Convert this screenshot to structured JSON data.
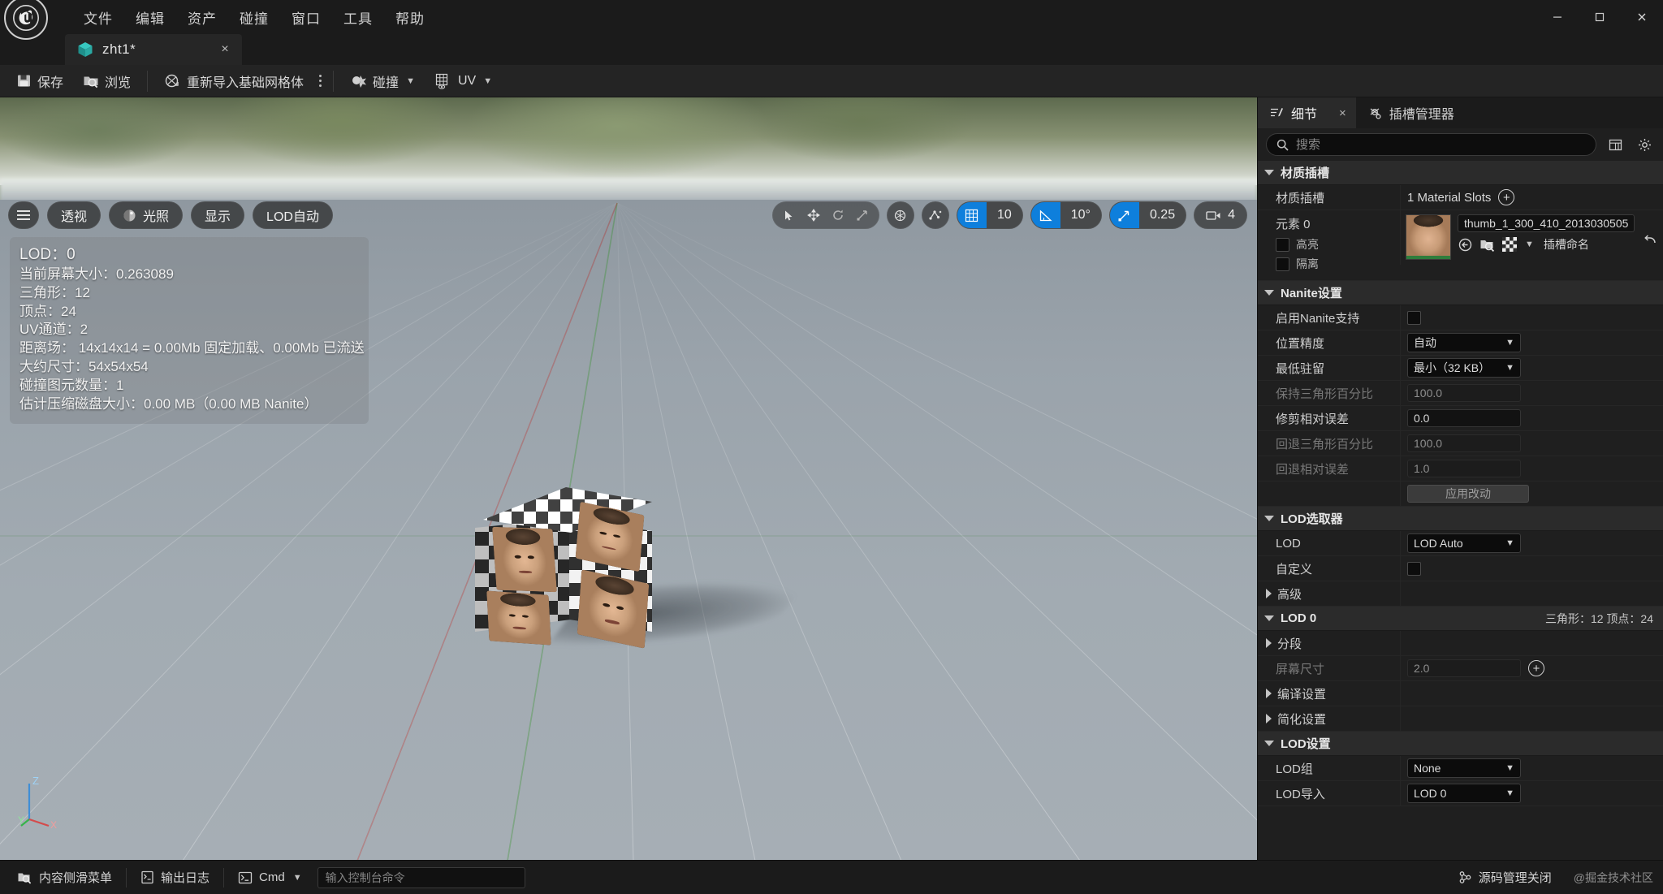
{
  "titlebar": {
    "logo": "unreal-engine-logo",
    "menu": [
      "文件",
      "编辑",
      "资产",
      "碰撞",
      "窗口",
      "工具",
      "帮助"
    ],
    "window_buttons": [
      "minimize",
      "maximize",
      "close"
    ]
  },
  "tabs": [
    {
      "label": "zht1*",
      "icon": "static-mesh-icon",
      "close": "×",
      "active": true
    }
  ],
  "toolbar": {
    "save": "保存",
    "browse": "浏览",
    "reimport": "重新导入基础网格体",
    "kebab": "more-options",
    "collision": "碰撞",
    "uv": "UV"
  },
  "viewport": {
    "left_controls": [
      {
        "name": "viewport-menu",
        "label": ""
      },
      {
        "name": "view-mode-perspective",
        "label": "透视"
      },
      {
        "name": "view-mode-lit",
        "label": "光照"
      },
      {
        "name": "show-menu",
        "label": "显示"
      },
      {
        "name": "lod-auto",
        "label": "LOD自动"
      }
    ],
    "transform_tools": [
      "select-tool",
      "translate-tool",
      "rotate-tool",
      "scale-tool"
    ],
    "coordinate_system": "world-coordinate-icon",
    "surface_snapping": "surface-snap-icon",
    "grid_snap": {
      "enabled": true,
      "value": "10"
    },
    "angle_snap": {
      "enabled": true,
      "value": "10°"
    },
    "scale_snap": {
      "enabled": true,
      "value": "0.25"
    },
    "camera_speed": {
      "value": "4"
    },
    "stats": [
      "LOD：0",
      "当前屏幕大小：0.263089",
      "三角形：12",
      "顶点：24",
      "UV通道：2",
      "距离场： 14x14x14 = 0.00Mb 固定加载、0.00Mb 已流送",
      "大约尺寸：54x54x54",
      "碰撞图元数量：1",
      "估计压缩磁盘大小：0.00 MB（0.00 MB Nanite）"
    ],
    "axis_labels": {
      "z": "Z",
      "y": "Y",
      "x": "X"
    }
  },
  "details_panel": {
    "tabs": [
      {
        "label": "细节",
        "icon": "details-icon",
        "active": true,
        "close": "×"
      },
      {
        "label": "插槽管理器",
        "icon": "socket-icon",
        "active": false
      }
    ],
    "search_placeholder": "搜索",
    "search_value": "",
    "toolbar_icons": [
      "column-layout-icon",
      "settings-gear-icon"
    ],
    "sections": [
      {
        "id": "material_slots",
        "title": "材质插槽",
        "expanded": true,
        "rows": [
          {
            "type": "text",
            "label": "材质插槽",
            "value": "1 Material Slots",
            "has_add": true
          }
        ],
        "element": {
          "title": "元素 0",
          "checks": [
            {
              "label": "高亮",
              "checked": false
            },
            {
              "label": "隔离",
              "checked": false
            }
          ],
          "material_name": "thumb_1_300_410_2013030505",
          "actions": [
            "browse-to-asset-icon",
            "find-in-content-browser-icon",
            "use-selected-asset-icon"
          ],
          "slot_name_label": "插槽命名",
          "revert": "revert-icon"
        }
      },
      {
        "id": "nanite_settings",
        "title": "Nanite设置",
        "expanded": true,
        "rows": [
          {
            "type": "checkbox",
            "label": "启用Nanite支持",
            "checked": false
          },
          {
            "type": "combo",
            "label": "位置精度",
            "value": "自动"
          },
          {
            "type": "combo",
            "label": "最低驻留",
            "value": "最小（32 KB）"
          },
          {
            "type": "number",
            "label": "保持三角形百分比",
            "value": "100.0",
            "disabled": true
          },
          {
            "type": "number",
            "label": "修剪相对误差",
            "value": "0.0",
            "disabled": false
          },
          {
            "type": "number",
            "label": "回退三角形百分比",
            "value": "100.0",
            "disabled": true
          },
          {
            "type": "number",
            "label": "回退相对误差",
            "value": "1.0",
            "disabled": true
          },
          {
            "type": "button",
            "label": "",
            "value": "应用改动"
          }
        ]
      },
      {
        "id": "lod_picker",
        "title": "LOD选取器",
        "expanded": true,
        "rows": [
          {
            "type": "combo",
            "label": "LOD",
            "value": "LOD Auto"
          },
          {
            "type": "checkbox",
            "label": "自定义",
            "checked": false
          },
          {
            "type": "subsection",
            "label": "高级",
            "expanded": false
          }
        ]
      },
      {
        "id": "lod0",
        "title": "LOD 0",
        "expanded": true,
        "note": "三角形：12   顶点：24",
        "rows": [
          {
            "type": "subsection",
            "label": "分段",
            "expanded": false
          },
          {
            "type": "number",
            "label": "屏幕尺寸",
            "value": "2.0",
            "disabled": true,
            "has_add": true
          },
          {
            "type": "subsection",
            "label": "编译设置",
            "expanded": false
          },
          {
            "type": "subsection",
            "label": "简化设置",
            "expanded": false
          }
        ]
      },
      {
        "id": "lod_settings",
        "title": "LOD设置",
        "expanded": true,
        "rows": [
          {
            "type": "combo",
            "label": "LOD组",
            "value": "None"
          },
          {
            "type": "combo",
            "label": "LOD导入",
            "value": "LOD 0"
          }
        ]
      }
    ]
  },
  "statusbar": {
    "content_drawer": "内容侧滑菜单",
    "output_log": "输出日志",
    "cmd_label": "Cmd",
    "cmd_placeholder": "输入控制台命令",
    "cmd_value": "",
    "source_control": "源码管理关闭",
    "watermark": "@掘金技术社区"
  },
  "colors": {
    "accent_blue": "#0e7fdc",
    "panel_bg": "#1f1f1f",
    "titlebar_bg": "#1b1b1b",
    "toolbar_bg": "#242424",
    "section_header": "#2b2b2b"
  }
}
